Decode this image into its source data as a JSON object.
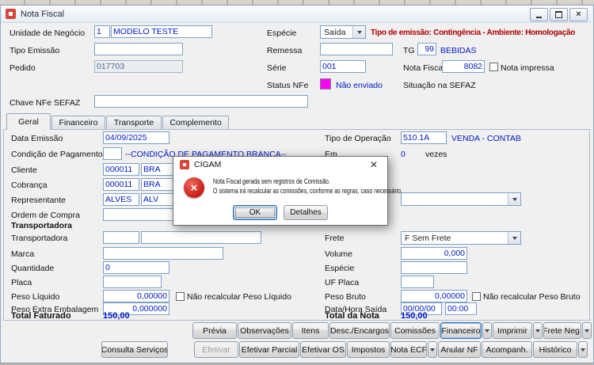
{
  "window": {
    "title": "Nota Fiscal"
  },
  "colors": {
    "banner_red": "#b00000",
    "value_blue": "#0018c8",
    "status_magenta": "#ff00ff"
  },
  "header": {
    "unidade_negocio": {
      "label": "Unidade de Negócio",
      "code": "1",
      "name": "MODELO TESTE"
    },
    "especie": {
      "label": "Espécie",
      "value": "Saída"
    },
    "banner": "Tipo de emissão: Contingência - Ambiente: Homologação",
    "tipo_emissao": {
      "label": "Tipo Emissão",
      "value": ""
    },
    "remessa": {
      "label": "Remessa",
      "value": ""
    },
    "tg": {
      "label": "TG",
      "code": "99",
      "name": "BEBIDAS"
    },
    "pedido": {
      "label": "Pedido",
      "value": "017703"
    },
    "serie": {
      "label": "Série",
      "value": "001"
    },
    "nota_fiscal": {
      "label": "Nota Fiscal",
      "value": "8082"
    },
    "nota_impressa_label": "Nota impressa",
    "status_nfe": {
      "label": "Status NFe",
      "value": "Não enviado"
    },
    "situacao_sefaz_label": "Situação na SEFAZ",
    "chave_nfe": {
      "label": "Chave NFe SEFAZ",
      "value": ""
    }
  },
  "tabs": [
    {
      "label": "Geral"
    },
    {
      "label": "Financeiro"
    },
    {
      "label": "Transporte"
    },
    {
      "label": "Complemento"
    }
  ],
  "geral": {
    "data_emissao": {
      "label": "Data Emissão",
      "value": "04/09/2025"
    },
    "tipo_operacao": {
      "label": "Tipo de Operação",
      "code": "510.1A",
      "name": "VENDA - CONTAB"
    },
    "condicao_pagamento": {
      "label": "Condição de Pagamento",
      "code": "",
      "name": "--CONDIÇÃO DE PAGAMENTO BRANCA--"
    },
    "em": {
      "label": "Em",
      "value": "0",
      "suffix": "vezes"
    },
    "cliente": {
      "label": "Cliente",
      "code": "000011",
      "name": "BRA"
    },
    "cobranca": {
      "label": "Cobrança",
      "code": "000011",
      "name": "BRA"
    },
    "representante": {
      "label": "Representante",
      "code": "ALVES",
      "name": "ALV"
    },
    "ordem_compra": {
      "label": "Ordem de Compra",
      "value": ""
    },
    "section_transportadora": "Transportadora",
    "transportadora": {
      "label": "Transportadora",
      "code": "",
      "name": ""
    },
    "frete": {
      "label": "Frete",
      "value": "F Sem Frete"
    },
    "marca": {
      "label": "Marca",
      "value": ""
    },
    "volume": {
      "label": "Volume",
      "value": "0,000"
    },
    "quantidade": {
      "label": "Quantidade",
      "value": "0"
    },
    "especie_item": {
      "label": "Espécie",
      "value": ""
    },
    "placa": {
      "label": "Placa",
      "value": ""
    },
    "uf_placa": {
      "label": "UF Placa",
      "value": ""
    },
    "peso_liquido": {
      "label": "Peso Líquido",
      "value": "0,00000",
      "checkbox": "Não recalcular Peso Líquido"
    },
    "peso_bruto": {
      "label": "Peso Bruto",
      "value": "0,00000",
      "checkbox": "Não recalcular Peso Bruto"
    },
    "peso_extra": {
      "label": "Peso Extra Embalagem",
      "value": "0,000000"
    },
    "data_hora_saida": {
      "label": "Data/Hora Saída",
      "date": "00/00/00",
      "time": "00:00"
    },
    "total_faturado": {
      "label": "Total Faturado",
      "value": "150,00"
    },
    "total_nota": {
      "label": "Total da Nota",
      "value": "150,00"
    }
  },
  "dialog": {
    "title": "CIGAM",
    "message_line1": "Nota Fiscal gerada sem registros de Comissão.",
    "message_line2": "O sistema irá recalcular as comissões, conforme as regras, caso necessário.",
    "ok_label": "OK",
    "detalhes_label": "Detalhes"
  },
  "actions": {
    "row1": [
      {
        "label": "Prévia"
      },
      {
        "label": "Observações"
      },
      {
        "label": "Itens"
      },
      {
        "label": "Desc./Encargos"
      },
      {
        "label": "Comissões"
      },
      {
        "label": "Financeiro"
      },
      {
        "label": "Imprimir"
      },
      {
        "label": "Frete Neg."
      }
    ],
    "row2": [
      {
        "label": "Consulta Serviços"
      },
      {
        "label": "Efetivar",
        "disabled": true
      },
      {
        "label": "Efetivar Parcial"
      },
      {
        "label": "Efetivar OS"
      },
      {
        "label": "Impostos"
      },
      {
        "label": "Nota ECF"
      },
      {
        "label": "Anular NF"
      },
      {
        "label": "Acompanh."
      },
      {
        "label": "Histórico"
      }
    ]
  }
}
